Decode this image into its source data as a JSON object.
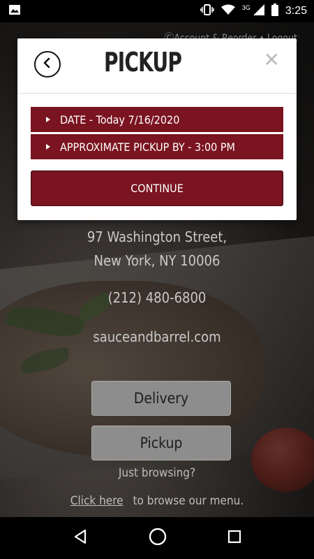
{
  "status_bar": {
    "network": "3G",
    "time": "3:25"
  },
  "background": {
    "account_text": "ⒸAccount & Reorder • Logout",
    "address_line1": "97 Washington Street,",
    "address_line2": "New York, NY 10006",
    "phone": "(212) 480-6800",
    "website": "sauceandbarrel.com",
    "delivery_label": "Delivery",
    "pickup_label": "Pickup",
    "just_browsing": "Just browsing?",
    "click_here": "Click here",
    "browse_text": "to browse our menu."
  },
  "modal": {
    "title": "PICKUP",
    "close_glyph": "✕",
    "date_row": "DATE - Today 7/16/2020",
    "time_row": "APPROXIMATE PICKUP BY - 3:00 PM",
    "continue_label": "CONTINUE"
  },
  "icons": {
    "status_left": "image-icon",
    "vibrate": "vibrate-icon",
    "wifi": "wifi-icon",
    "signal": "signal-icon",
    "battery": "battery-icon",
    "back": "back-arrow-icon",
    "nav_back": "nav-back-icon",
    "nav_home": "nav-home-icon",
    "nav_recents": "nav-recents-icon"
  },
  "colors": {
    "accent": "#7a1420",
    "modal_bg": "#ffffff",
    "status_bar": "#000000"
  }
}
